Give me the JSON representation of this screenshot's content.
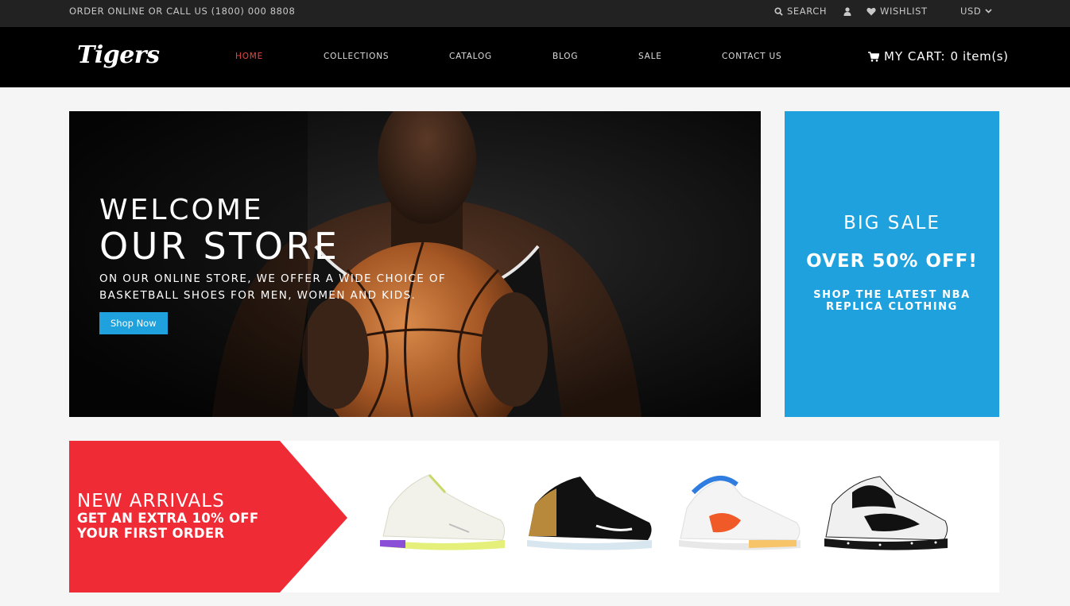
{
  "topbar": {
    "order_text": "ORDER ONLINE OR CALL US (1800) 000 8808",
    "search_label": "SEARCH",
    "wishlist_label": "WISHLIST",
    "currency": "USD"
  },
  "header": {
    "logo_text": "Tigers",
    "nav": [
      "HOME",
      "COLLECTIONS",
      "CATALOG",
      "BLOG",
      "SALE",
      "CONTACT US"
    ],
    "active_nav": "HOME",
    "cart_label": "MY CART:",
    "cart_count": "0 item(s)"
  },
  "hero": {
    "welcome": "WELCOME",
    "our_store": "OUR STORE",
    "description": "ON OUR ONLINE STORE, WE OFFER A WIDE CHOICE OF BASKETBALL SHOES FOR MEN, WOMEN AND KIDS.",
    "cta": "Shop Now"
  },
  "promo": {
    "title": "BIG SALE",
    "offer": "OVER 50% OFF!",
    "subtitle": "SHOP THE LATEST NBA REPLICA CLOTHING"
  },
  "arrivals": {
    "title": "NEW ARRIVALS",
    "subtitle": "GET AN EXTRA 10% OFF YOUR FIRST ORDER"
  },
  "colors": {
    "accent_red": "#e8473f",
    "promo_blue": "#1ea1dc",
    "arrivals_red": "#ef2b36"
  }
}
